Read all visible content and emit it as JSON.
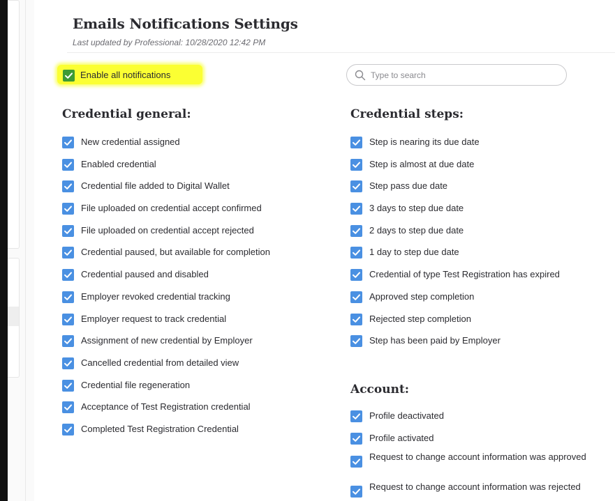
{
  "header": {
    "title": "Emails Notifications Settings",
    "subtitle": "Last updated by Professional: 10/28/2020 12:42 PM"
  },
  "enable_all": {
    "label": "Enable all notifications",
    "checked": true,
    "highlight_color": "#fbff33"
  },
  "search": {
    "placeholder": "Type to search",
    "value": "",
    "icon": "search-icon"
  },
  "colors": {
    "checkbox": "#4a90e2",
    "enable_all_checkbox": "#3d9a35"
  },
  "sections": {
    "credential_general": {
      "title": "Credential general:",
      "items": [
        {
          "label": "New credential assigned",
          "checked": true
        },
        {
          "label": "Enabled credential",
          "checked": true
        },
        {
          "label": "Credential file added to Digital Wallet",
          "checked": true
        },
        {
          "label": "File uploaded on credential accept confirmed",
          "checked": true
        },
        {
          "label": "File uploaded on credential accept rejected",
          "checked": true
        },
        {
          "label": "Credential paused, but available for completion",
          "checked": true
        },
        {
          "label": "Credential paused and disabled",
          "checked": true
        },
        {
          "label": "Employer revoked credential tracking",
          "checked": true
        },
        {
          "label": "Employer request to track credential",
          "checked": true
        },
        {
          "label": "Assignment of new credential by Employer",
          "checked": true
        },
        {
          "label": "Cancelled credential from detailed view",
          "checked": true
        },
        {
          "label": "Credential file regeneration",
          "checked": true
        },
        {
          "label": "Acceptance of Test Registration credential",
          "checked": true
        },
        {
          "label": "Completed Test Registration Credential",
          "checked": true
        }
      ]
    },
    "credential_steps": {
      "title": "Credential steps:",
      "items": [
        {
          "label": "Step is nearing its due date",
          "checked": true
        },
        {
          "label": "Step is almost at due date",
          "checked": true
        },
        {
          "label": "Step pass due date",
          "checked": true
        },
        {
          "label": "3 days to step due date",
          "checked": true
        },
        {
          "label": "2 days to step due date",
          "checked": true
        },
        {
          "label": "1 day to step due date",
          "checked": true
        },
        {
          "label": "Credential of type Test Registration has expired",
          "checked": true
        },
        {
          "label": "Approved step completion",
          "checked": true
        },
        {
          "label": "Rejected step completion",
          "checked": true
        },
        {
          "label": "Step has been paid by Employer",
          "checked": true
        }
      ]
    },
    "account": {
      "title": "Account:",
      "items": [
        {
          "label": "Profile deactivated",
          "checked": true
        },
        {
          "label": "Profile activated",
          "checked": true
        },
        {
          "label": "Request to change account information was approved",
          "checked": true
        },
        {
          "label": "Request to change account information was rejected",
          "checked": true
        }
      ]
    }
  }
}
